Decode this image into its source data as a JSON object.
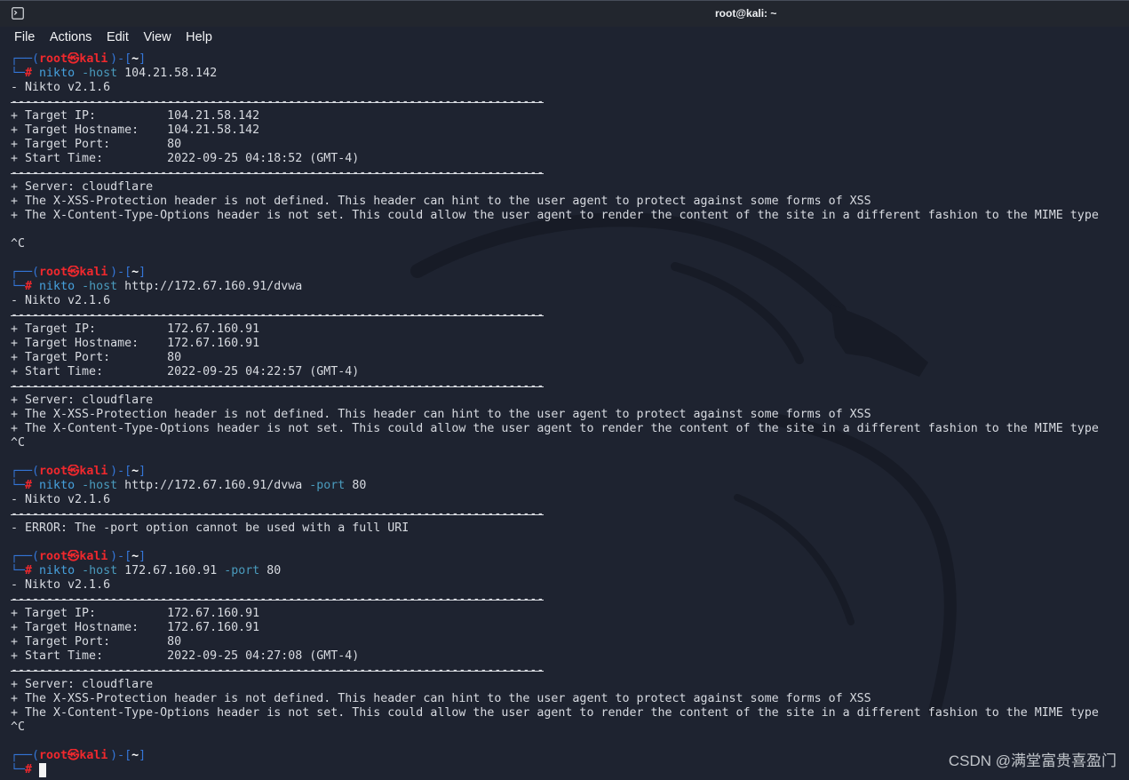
{
  "window": {
    "title": "root@kali: ~",
    "icon": "terminal-icon"
  },
  "menu": {
    "items": [
      "File",
      "Actions",
      "Edit",
      "View",
      "Help"
    ]
  },
  "colors": {
    "background": "#1e2330",
    "titlebar": "#22262e",
    "prompt_frame": "#3476d8",
    "prompt_user": "#f0282d",
    "prompt_dir": "#ffffff",
    "command": "#46a0dc",
    "option": "#4a9bbd",
    "output": "#d7dae0",
    "cursor": "#f4f4f4"
  },
  "terminal": {
    "lines": [
      {
        "segments": [
          {
            "text": "┌──(",
            "style": "frame"
          },
          {
            "text": "root㉿kali",
            "style": "user"
          },
          {
            "text": ")-[",
            "style": "frame"
          },
          {
            "text": "~",
            "style": "dir"
          },
          {
            "text": "]",
            "style": "frame"
          }
        ]
      },
      {
        "segments": [
          {
            "text": "└─",
            "style": "frame"
          },
          {
            "text": "#",
            "style": "hash"
          },
          {
            "text": " ",
            "style": "output"
          },
          {
            "text": "nikto",
            "style": "command"
          },
          {
            "text": " ",
            "style": "output"
          },
          {
            "text": "-host",
            "style": "option"
          },
          {
            "text": " 104.21.58.142",
            "style": "output"
          }
        ]
      },
      {
        "segments": [
          {
            "text": "- Nikto v2.1.6",
            "style": "output"
          }
        ]
      },
      {
        "segments": [
          {
            "text": "---------------------------------------------------------------------------",
            "style": "separator"
          }
        ]
      },
      {
        "segments": [
          {
            "text": "+ Target IP:          104.21.58.142",
            "style": "output"
          }
        ]
      },
      {
        "segments": [
          {
            "text": "+ Target Hostname:    104.21.58.142",
            "style": "output"
          }
        ]
      },
      {
        "segments": [
          {
            "text": "+ Target Port:        80",
            "style": "output"
          }
        ]
      },
      {
        "segments": [
          {
            "text": "+ Start Time:         2022-09-25 04:18:52 (GMT-4)",
            "style": "output"
          }
        ]
      },
      {
        "segments": [
          {
            "text": "---------------------------------------------------------------------------",
            "style": "separator"
          }
        ]
      },
      {
        "segments": [
          {
            "text": "+ Server: cloudflare",
            "style": "output"
          }
        ]
      },
      {
        "segments": [
          {
            "text": "+ The X-XSS-Protection header is not defined. This header can hint to the user agent to protect against some forms of XSS",
            "style": "output"
          }
        ]
      },
      {
        "segments": [
          {
            "text": "+ The X-Content-Type-Options header is not set. This could allow the user agent to render the content of the site in a different fashion to the MIME type",
            "style": "output"
          }
        ]
      },
      {
        "segments": []
      },
      {
        "segments": [
          {
            "text": "^C",
            "style": "output"
          }
        ]
      },
      {
        "segments": []
      },
      {
        "segments": [
          {
            "text": "┌──(",
            "style": "frame"
          },
          {
            "text": "root㉿kali",
            "style": "user"
          },
          {
            "text": ")-[",
            "style": "frame"
          },
          {
            "text": "~",
            "style": "dir"
          },
          {
            "text": "]",
            "style": "frame"
          }
        ]
      },
      {
        "segments": [
          {
            "text": "└─",
            "style": "frame"
          },
          {
            "text": "#",
            "style": "hash"
          },
          {
            "text": " ",
            "style": "output"
          },
          {
            "text": "nikto",
            "style": "command"
          },
          {
            "text": " ",
            "style": "output"
          },
          {
            "text": "-host",
            "style": "option"
          },
          {
            "text": " http://172.67.160.91/dvwa",
            "style": "output"
          }
        ]
      },
      {
        "segments": [
          {
            "text": "- Nikto v2.1.6",
            "style": "output"
          }
        ]
      },
      {
        "segments": [
          {
            "text": "---------------------------------------------------------------------------",
            "style": "separator"
          }
        ]
      },
      {
        "segments": [
          {
            "text": "+ Target IP:          172.67.160.91",
            "style": "output"
          }
        ]
      },
      {
        "segments": [
          {
            "text": "+ Target Hostname:    172.67.160.91",
            "style": "output"
          }
        ]
      },
      {
        "segments": [
          {
            "text": "+ Target Port:        80",
            "style": "output"
          }
        ]
      },
      {
        "segments": [
          {
            "text": "+ Start Time:         2022-09-25 04:22:57 (GMT-4)",
            "style": "output"
          }
        ]
      },
      {
        "segments": [
          {
            "text": "---------------------------------------------------------------------------",
            "style": "separator"
          }
        ]
      },
      {
        "segments": [
          {
            "text": "+ Server: cloudflare",
            "style": "output"
          }
        ]
      },
      {
        "segments": [
          {
            "text": "+ The X-XSS-Protection header is not defined. This header can hint to the user agent to protect against some forms of XSS",
            "style": "output"
          }
        ]
      },
      {
        "segments": [
          {
            "text": "+ The X-Content-Type-Options header is not set. This could allow the user agent to render the content of the site in a different fashion to the MIME type",
            "style": "output"
          }
        ]
      },
      {
        "segments": [
          {
            "text": "^C",
            "style": "output"
          }
        ]
      },
      {
        "segments": []
      },
      {
        "segments": [
          {
            "text": "┌──(",
            "style": "frame"
          },
          {
            "text": "root㉿kali",
            "style": "user"
          },
          {
            "text": ")-[",
            "style": "frame"
          },
          {
            "text": "~",
            "style": "dir"
          },
          {
            "text": "]",
            "style": "frame"
          }
        ]
      },
      {
        "segments": [
          {
            "text": "└─",
            "style": "frame"
          },
          {
            "text": "#",
            "style": "hash"
          },
          {
            "text": " ",
            "style": "output"
          },
          {
            "text": "nikto",
            "style": "command"
          },
          {
            "text": " ",
            "style": "output"
          },
          {
            "text": "-host",
            "style": "option"
          },
          {
            "text": " http://172.67.160.91/dvwa ",
            "style": "output"
          },
          {
            "text": "-port",
            "style": "option"
          },
          {
            "text": " 80",
            "style": "output"
          }
        ]
      },
      {
        "segments": [
          {
            "text": "- Nikto v2.1.6",
            "style": "output"
          }
        ]
      },
      {
        "segments": [
          {
            "text": "---------------------------------------------------------------------------",
            "style": "separator"
          }
        ]
      },
      {
        "segments": [
          {
            "text": "- ERROR: The -port option cannot be used with a full URI",
            "style": "output"
          }
        ]
      },
      {
        "segments": []
      },
      {
        "segments": [
          {
            "text": "┌──(",
            "style": "frame"
          },
          {
            "text": "root㉿kali",
            "style": "user"
          },
          {
            "text": ")-[",
            "style": "frame"
          },
          {
            "text": "~",
            "style": "dir"
          },
          {
            "text": "]",
            "style": "frame"
          }
        ]
      },
      {
        "segments": [
          {
            "text": "└─",
            "style": "frame"
          },
          {
            "text": "#",
            "style": "hash"
          },
          {
            "text": " ",
            "style": "output"
          },
          {
            "text": "nikto",
            "style": "command"
          },
          {
            "text": " ",
            "style": "output"
          },
          {
            "text": "-host",
            "style": "option"
          },
          {
            "text": " 172.67.160.91 ",
            "style": "output"
          },
          {
            "text": "-port",
            "style": "option"
          },
          {
            "text": " 80",
            "style": "output"
          }
        ]
      },
      {
        "segments": [
          {
            "text": "- Nikto v2.1.6",
            "style": "output"
          }
        ]
      },
      {
        "segments": [
          {
            "text": "---------------------------------------------------------------------------",
            "style": "separator"
          }
        ]
      },
      {
        "segments": [
          {
            "text": "+ Target IP:          172.67.160.91",
            "style": "output"
          }
        ]
      },
      {
        "segments": [
          {
            "text": "+ Target Hostname:    172.67.160.91",
            "style": "output"
          }
        ]
      },
      {
        "segments": [
          {
            "text": "+ Target Port:        80",
            "style": "output"
          }
        ]
      },
      {
        "segments": [
          {
            "text": "+ Start Time:         2022-09-25 04:27:08 (GMT-4)",
            "style": "output"
          }
        ]
      },
      {
        "segments": [
          {
            "text": "---------------------------------------------------------------------------",
            "style": "separator"
          }
        ]
      },
      {
        "segments": [
          {
            "text": "+ Server: cloudflare",
            "style": "output"
          }
        ]
      },
      {
        "segments": [
          {
            "text": "+ The X-XSS-Protection header is not defined. This header can hint to the user agent to protect against some forms of XSS",
            "style": "output"
          }
        ]
      },
      {
        "segments": [
          {
            "text": "+ The X-Content-Type-Options header is not set. This could allow the user agent to render the content of the site in a different fashion to the MIME type",
            "style": "output"
          }
        ]
      },
      {
        "segments": [
          {
            "text": "^C",
            "style": "output"
          }
        ]
      },
      {
        "segments": []
      },
      {
        "segments": [
          {
            "text": "┌──(",
            "style": "frame"
          },
          {
            "text": "root㉿kali",
            "style": "user"
          },
          {
            "text": ")-[",
            "style": "frame"
          },
          {
            "text": "~",
            "style": "dir"
          },
          {
            "text": "]",
            "style": "frame"
          }
        ]
      },
      {
        "segments": [
          {
            "text": "└─",
            "style": "frame"
          },
          {
            "text": "#",
            "style": "hash"
          },
          {
            "text": " ",
            "style": "output"
          },
          {
            "text": " ",
            "style": "cursor"
          }
        ]
      }
    ]
  },
  "watermark": {
    "text": "CSDN @满堂富贵喜盈门"
  }
}
